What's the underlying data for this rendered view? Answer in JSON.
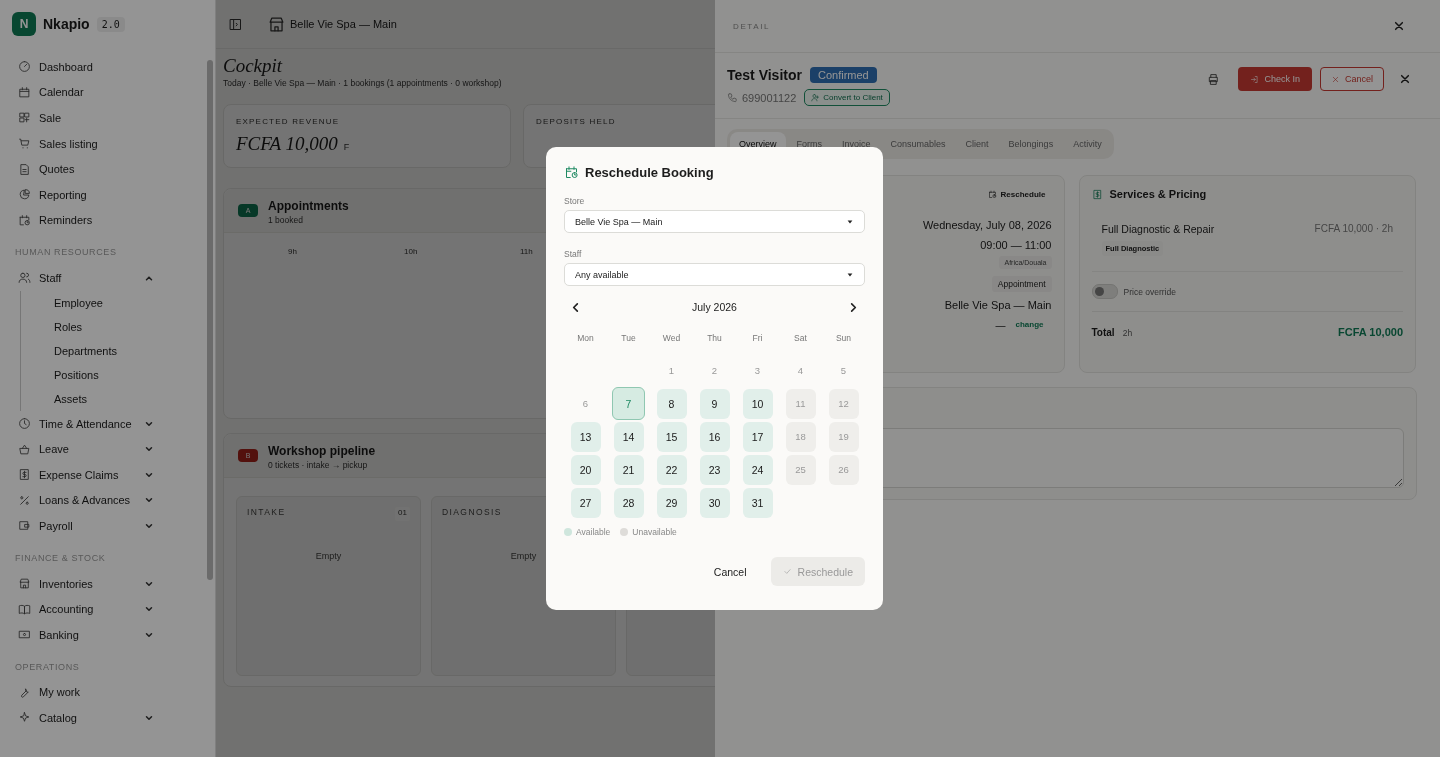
{
  "sidebar": {
    "logo_letter": "N",
    "app_name": "Nkapio",
    "version": "2.0",
    "sections": [
      {
        "items": [
          {
            "label": "Dashboard"
          },
          {
            "label": "Calendar"
          },
          {
            "label": "Sale"
          },
          {
            "label": "Sales listing"
          },
          {
            "label": "Quotes"
          },
          {
            "label": "Reporting"
          },
          {
            "label": "Reminders"
          }
        ]
      },
      {
        "heading": "HUMAN RESOURCES",
        "items": [
          {
            "label": "Staff",
            "expanded": true,
            "children": [
              {
                "label": "Employee"
              },
              {
                "label": "Roles"
              },
              {
                "label": "Departments"
              },
              {
                "label": "Positions"
              },
              {
                "label": "Assets"
              }
            ]
          },
          {
            "label": "Time & Attendance",
            "expanded": false
          },
          {
            "label": "Leave",
            "expanded": false
          },
          {
            "label": "Expense Claims",
            "expanded": false
          },
          {
            "label": "Loans & Advances",
            "expanded": false
          },
          {
            "label": "Payroll",
            "expanded": false
          }
        ]
      },
      {
        "heading": "FINANCE & STOCK",
        "items": [
          {
            "label": "Inventories",
            "expanded": false
          },
          {
            "label": "Accounting",
            "expanded": false
          },
          {
            "label": "Banking",
            "expanded": false
          }
        ]
      },
      {
        "heading": "OPERATIONS",
        "items": [
          {
            "label": "My work"
          },
          {
            "label": "Catalog",
            "expanded": false
          }
        ]
      }
    ]
  },
  "topbar": {
    "store": "Belle Vie Spa — Main"
  },
  "cockpit": {
    "title": "Cockpit",
    "subtitle": "Today · Belle Vie Spa — Main · 1 bookings (1 appointments · 0 workshop)",
    "stats": [
      {
        "label": "EXPECTED REVENUE",
        "value": "FCFA 10,000",
        "unit": "F"
      },
      {
        "label": "DEPOSITS HELD"
      }
    ],
    "appointments": {
      "badge": "A",
      "title": "Appointments",
      "subtitle": "1 booked",
      "hours": [
        "9h",
        "10h",
        "11h"
      ]
    },
    "workshop": {
      "badge": "B",
      "title": "Workshop pipeline",
      "subtitle": "0 tickets · intake → pickup",
      "columns": [
        {
          "title": "INTAKE",
          "count": "01",
          "empty": "Empty"
        },
        {
          "title": "DIAGNOSIS",
          "empty": "Empty"
        },
        {}
      ]
    }
  },
  "detail": {
    "heading": "DETAIL",
    "name": "Test Visitor",
    "status": "Confirmed",
    "phone": "699001122",
    "convert_button": "Convert to Client",
    "check_in": "Check In",
    "cancel": "Cancel",
    "tabs": [
      {
        "label": "Overview",
        "selected": true
      },
      {
        "label": "Forms",
        "selected": false
      },
      {
        "label": "Invoice",
        "selected": false
      },
      {
        "label": "Consumables",
        "selected": false
      },
      {
        "label": "Client",
        "selected": false
      },
      {
        "label": "Belongings",
        "selected": false
      },
      {
        "label": "Activity",
        "selected": false
      }
    ],
    "booking": {
      "reschedule": "Reschedule",
      "date": "Wednesday, July 08, 2026",
      "time": "09:00 — 11:00",
      "timezone": "Africa/Douala",
      "type": "Appointment",
      "store": "Belle Vie Spa — Main",
      "staff": "—",
      "change": "change"
    },
    "services": {
      "title": "Services & Pricing",
      "items": [
        {
          "name": "Full Diagnostic & Repair",
          "price": "FCFA 10,000 · 2h",
          "tag": "Full Diagnostic"
        }
      ],
      "price_override": {
        "label": "Price override",
        "on": false
      },
      "total_label": "Total",
      "total_duration": "2h",
      "total": "FCFA 10,000"
    }
  },
  "modal": {
    "title": "Reschedule Booking",
    "store_label": "Store",
    "store_value": "Belle Vie Spa — Main",
    "staff_label": "Staff",
    "staff_value": "Any available",
    "month": "July 2026",
    "weekdays": [
      "Mon",
      "Tue",
      "Wed",
      "Thu",
      "Fri",
      "Sat",
      "Sun"
    ],
    "days": [
      {
        "kind": "blank"
      },
      {
        "kind": "blank"
      },
      {
        "day": "1",
        "kind": "past",
        "selected": false
      },
      {
        "day": "2",
        "kind": "past",
        "selected": false
      },
      {
        "day": "3",
        "kind": "past",
        "selected": false
      },
      {
        "day": "4",
        "kind": "past",
        "selected": false
      },
      {
        "day": "5",
        "kind": "past",
        "selected": false
      },
      {
        "day": "6",
        "kind": "past",
        "selected": false
      },
      {
        "day": "7",
        "kind": "available",
        "selected": true
      },
      {
        "day": "8",
        "kind": "available",
        "selected": false
      },
      {
        "day": "9",
        "kind": "available",
        "selected": false
      },
      {
        "day": "10",
        "kind": "available",
        "selected": false
      },
      {
        "day": "11",
        "kind": "unavailable",
        "selected": false
      },
      {
        "day": "12",
        "kind": "unavailable",
        "selected": false
      },
      {
        "day": "13",
        "kind": "available",
        "selected": false
      },
      {
        "day": "14",
        "kind": "available",
        "selected": false
      },
      {
        "day": "15",
        "kind": "available",
        "selected": false
      },
      {
        "day": "16",
        "kind": "available",
        "selected": false
      },
      {
        "day": "17",
        "kind": "available",
        "selected": false
      },
      {
        "day": "18",
        "kind": "unavailable",
        "selected": false
      },
      {
        "day": "19",
        "kind": "unavailable",
        "selected": false
      },
      {
        "day": "20",
        "kind": "available",
        "selected": false
      },
      {
        "day": "21",
        "kind": "available",
        "selected": false
      },
      {
        "day": "22",
        "kind": "available",
        "selected": false
      },
      {
        "day": "23",
        "kind": "available",
        "selected": false
      },
      {
        "day": "24",
        "kind": "available",
        "selected": false
      },
      {
        "day": "25",
        "kind": "unavailable",
        "selected": false
      },
      {
        "day": "26",
        "kind": "unavailable",
        "selected": false
      },
      {
        "day": "27",
        "kind": "available",
        "selected": false
      },
      {
        "day": "28",
        "kind": "available",
        "selected": false
      },
      {
        "day": "29",
        "kind": "available",
        "selected": false
      },
      {
        "day": "30",
        "kind": "available",
        "selected": false
      },
      {
        "day": "31",
        "kind": "available",
        "selected": false
      }
    ],
    "legend": [
      {
        "label": "Available",
        "kind": "available"
      },
      {
        "label": "Unavailable",
        "kind": "unavailable"
      }
    ],
    "cancel": "Cancel",
    "confirm": {
      "label": "Reschedule",
      "disabled": true
    }
  }
}
